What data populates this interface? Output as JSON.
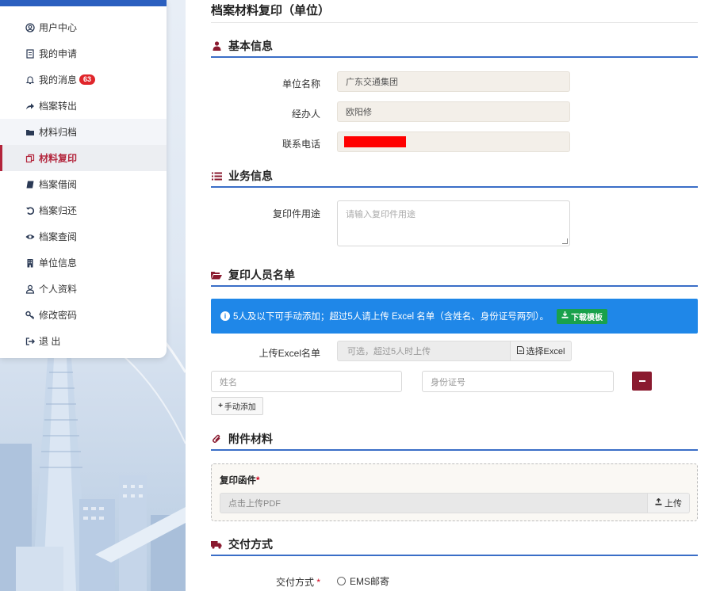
{
  "sidebar": {
    "items": [
      {
        "label": "用户中心",
        "icon": "user-circle-icon"
      },
      {
        "label": "我的申请",
        "icon": "document-icon"
      },
      {
        "label": "我的消息",
        "icon": "bell-icon",
        "badge": "63"
      },
      {
        "label": "档案转出",
        "icon": "share-arrow-icon"
      },
      {
        "label": "材料归档",
        "icon": "folder-icon"
      },
      {
        "label": "材料复印",
        "icon": "copy-icon"
      },
      {
        "label": "档案借阅",
        "icon": "book-icon"
      },
      {
        "label": "档案归还",
        "icon": "undo-icon"
      },
      {
        "label": "档案查阅",
        "icon": "eye-icon"
      },
      {
        "label": "单位信息",
        "icon": "building-icon"
      },
      {
        "label": "个人资料",
        "icon": "person-icon"
      },
      {
        "label": "修改密码",
        "icon": "key-icon"
      },
      {
        "label": "退 出",
        "icon": "logout-icon"
      }
    ],
    "active_index": 5
  },
  "page": {
    "title": "档案材料复印（单位）"
  },
  "basic_info": {
    "heading": "基本信息",
    "unit_name_label": "单位名称",
    "unit_name_value": "广东交通集团",
    "handler_label": "经办人",
    "handler_value": "欧阳修",
    "phone_label": "联系电话"
  },
  "business_info": {
    "heading": "业务信息",
    "purpose_label": "复印件用途",
    "purpose_placeholder": "请输入复印件用途"
  },
  "personnel": {
    "heading": "复印人员名单",
    "notice": "5人及以下可手动添加；超过5人请上传 Excel 名单（含姓名、身份证号两列）。",
    "download_label": "下载模板",
    "upload_label": "上传Excel名单",
    "upload_placeholder": "可选，超过5人时上传",
    "choose_excel_label": "选择Excel",
    "name_placeholder": "姓名",
    "id_placeholder": "身份证号",
    "add_manual_label": "手动添加"
  },
  "attachments": {
    "heading": "附件材料",
    "letter_label": "复印函件",
    "required_mark": "*",
    "pdf_placeholder": "点击上传PDF",
    "upload_label": "上传"
  },
  "delivery": {
    "heading": "交付方式",
    "method_label": "交付方式",
    "required_mark": "*",
    "option_ems": "EMS邮寄"
  },
  "colors": {
    "accent_blue": "#3a6ec7",
    "info_blue": "#1f87e8",
    "danger_red": "#8a1a2f",
    "badge_red": "#e0262b",
    "download_green": "#19a14b"
  }
}
